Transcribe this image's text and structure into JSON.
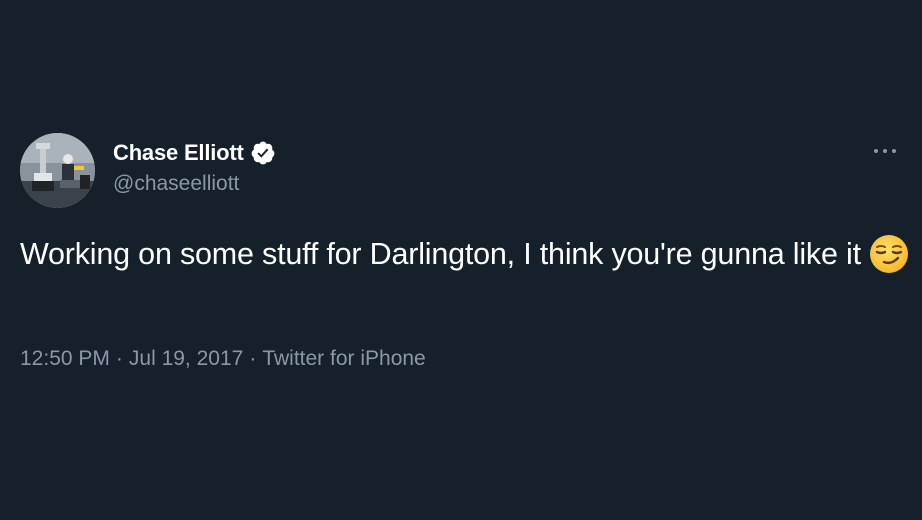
{
  "author": {
    "display_name": "Chase Elliott",
    "handle": "@chaseelliott",
    "verified": true,
    "avatar_icon": "avatar-photo-trophy"
  },
  "tweet": {
    "text": "Working on some stuff for Darlington, I think you're gunna like it",
    "emoji": "😏",
    "emoji_icon": "smirking-face-icon"
  },
  "meta": {
    "time": "12:50 PM",
    "date": "Jul 19, 2017",
    "source": "Twitter for iPhone",
    "separator": "·"
  },
  "menu": {
    "icon": "more-horizontal-icon"
  },
  "colors": {
    "background": "#15202b",
    "primary_text": "#ffffff",
    "secondary_text": "#8899a6"
  }
}
